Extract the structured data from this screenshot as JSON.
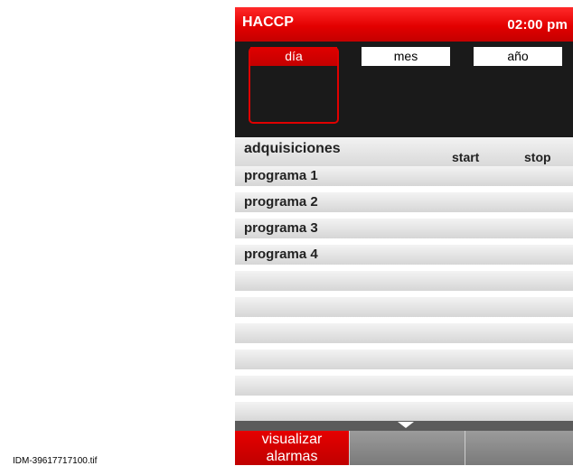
{
  "header": {
    "title": "HACCP",
    "time": "02:00 pm"
  },
  "date_selector": {
    "day_label": "día",
    "month_label": "mes",
    "year_label": "año"
  },
  "table": {
    "title": "adquisiciones",
    "col_start": "start",
    "col_stop": "stop",
    "rows": [
      "programa 1",
      "programa 2",
      "programa 3",
      "programa 4"
    ]
  },
  "bottom_bar": {
    "tab1_label": "visualizar alarmas"
  },
  "footer": {
    "filename": "IDM-39617717100.tif"
  },
  "colors": {
    "accent_red": "#e30000",
    "panel_dark": "#1a1a1a",
    "scrollbar": "#5b5b5b"
  }
}
